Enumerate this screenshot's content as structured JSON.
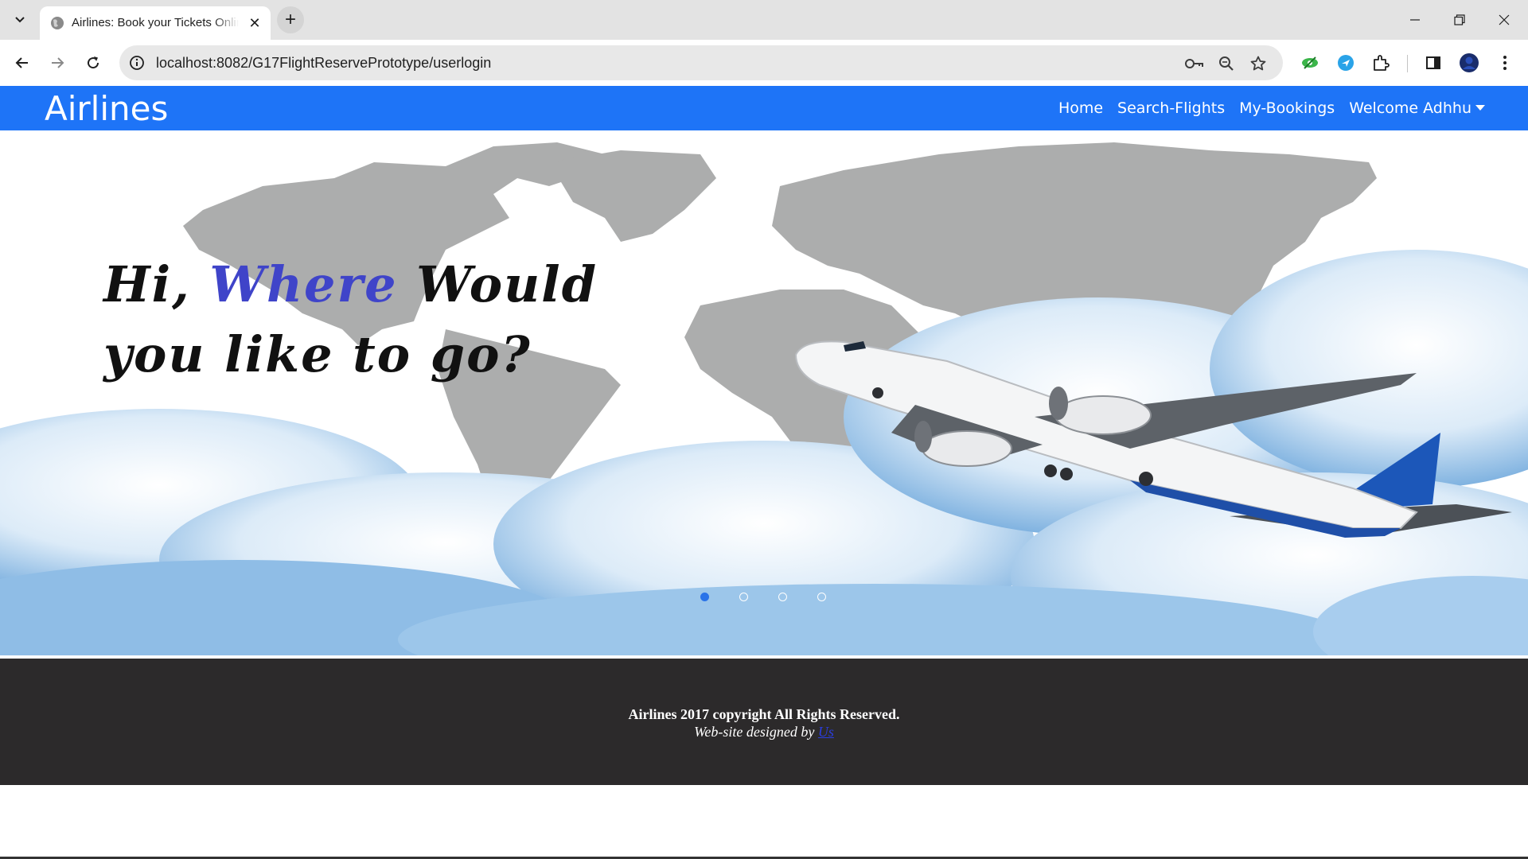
{
  "browser": {
    "tab_title": "Airlines: Book your Tickets Online",
    "url": "localhost:8082/G17FlightReservePrototype/userlogin",
    "icons": [
      "tab-list-icon",
      "globe-icon",
      "close-icon",
      "plus-icon",
      "minimize-icon",
      "restore-icon",
      "close-window-icon",
      "back-arrow-icon",
      "forward-arrow-icon",
      "reload-icon",
      "site-info-icon",
      "key-icon",
      "zoom-icon",
      "star-icon",
      "extension-eye-icon",
      "extension-blue-icon",
      "puzzle-icon",
      "side-panel-icon",
      "profile-avatar",
      "kebab-menu-icon"
    ]
  },
  "site": {
    "brand": "Airlines",
    "brand_color": "#1e74f7",
    "nav": [
      {
        "label": "Home"
      },
      {
        "label": "Search-Flights"
      },
      {
        "label": "My-Bookings"
      },
      {
        "label": "Welcome Adhhu"
      }
    ]
  },
  "hero": {
    "line1_part1": "Hi, ",
    "line1_accent": "Where",
    "line1_part2": " Would",
    "line2": "you like to go?",
    "accent_color": "#3f44c9",
    "slides_total": 4,
    "active_slide": 1
  },
  "footer": {
    "copyright": "Airlines 2017 copyright All Rights Reserved.",
    "designed_by_prefix": "Web-site designed by ",
    "designed_by_link": "Us"
  }
}
